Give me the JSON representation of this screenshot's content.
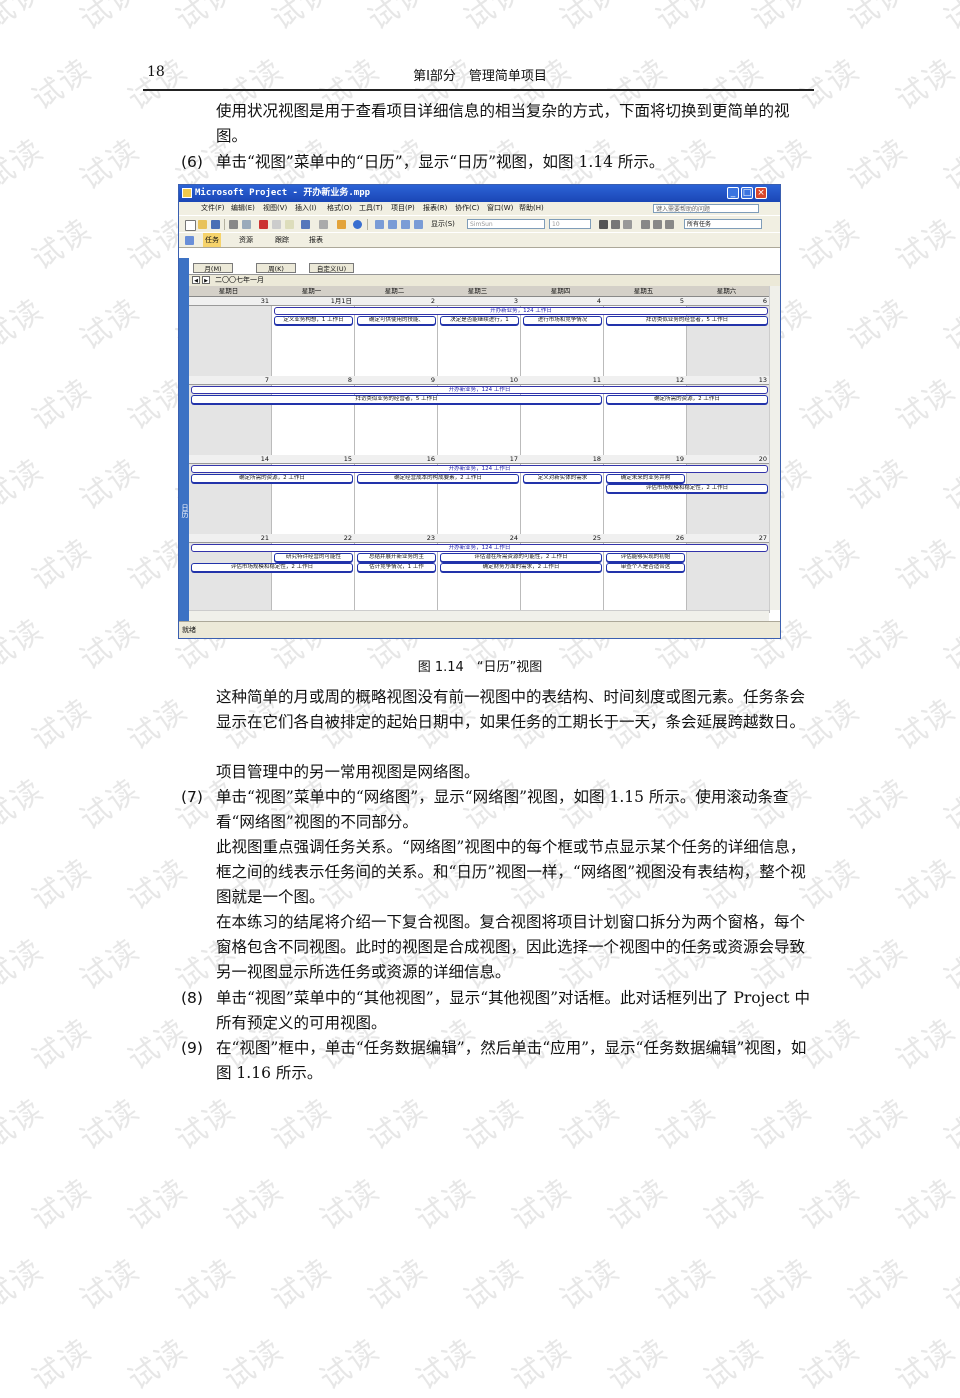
{
  "header": {
    "page_number": "18",
    "running_head": "第Ⅰ部分　管理简单项目"
  },
  "watermark": "试读",
  "text": {
    "p_intro": "使用状况视图是用于查看项目详细信息的相当复杂的方式，下面将切换到更简单的视图。",
    "step6_no": "(6)",
    "step6": "单击“视图”菜单中的“日历”，显示“日历”视图，如图 1.14 所示。",
    "p_simple": "这种简单的月或周的概略视图没有前一视图中的表结构、时间刻度或图元素。任务条会显示在它们各自被排定的起始日期中，如果任务的工期长于一天，条会延展跨越数日。",
    "p_network": "项目管理中的另一常用视图是网络图。",
    "step7_no": "(7)",
    "step7": "单击“视图”菜单中的“网络图”，显示“网络图”视图，如图 1.15 所示。使用滚动条查看“网络图”视图的不同部分。",
    "p_focus": "此视图重点强调任务关系。“网络图”视图中的每个框或节点显示某个任务的详细信息，框之间的线表示任务间的关系。和“日历”视图一样，“网络图”视图没有表结构，整个视图就是一个图。",
    "p_composite": "在本练习的结尾将介绍一下复合视图。复合视图将项目计划窗口拆分为两个窗格，每个窗格包含不同视图。此时的视图是合成视图，因此选择一个视图中的任务或资源会导致另一视图显示所选任务或资源的详细信息。",
    "step8_no": "(8)",
    "step8": "单击“视图”菜单中的“其他视图”，显示“其他视图”对话框。此对话框列出了 Project 中所有预定义的可用视图。",
    "step9_no": "(9)",
    "step9": "在“视图”框中，单击“任务数据编辑”，然后单击“应用”，显示“任务数据编辑”视图，如图 1.16 所示。"
  },
  "figure": {
    "caption": "图 1.14　“日历”视图",
    "window_title": "Microsoft Project - 开办新业务.mpp",
    "menu": [
      "文件(F)",
      "编辑(E)",
      "视图(V)",
      "插入(I)",
      "格式(O)",
      "工具(T)",
      "项目(P)",
      "报表(R)",
      "协作(C)",
      "窗口(W)",
      "帮助(H)"
    ],
    "help_placeholder": "键入需要帮助的问题",
    "toolbar_show": "显示(S)",
    "font_combo": "SimSun",
    "size_combo": "10",
    "filter_combo": "所有任务",
    "toolbar2": [
      "任务",
      "资源",
      "跟踪",
      "报表"
    ],
    "view_buttons": [
      "月(M)",
      "周(K)",
      "自定义(U)"
    ],
    "month_label": "二〇〇七年一月",
    "days": [
      "星期日",
      "星期一",
      "星期二",
      "星期三",
      "星期四",
      "星期五",
      "星期六"
    ],
    "view_bar_label": "日历",
    "status": "就绪",
    "weeks": [
      {
        "dates": [
          "31",
          "1月1日",
          "2",
          "3",
          "4",
          "5",
          "6"
        ],
        "summary": "开办新业务，124 工作日",
        "tasks": [
          "定义业务构想，1 工作日",
          "确定可供使用的技能、",
          "决定是否能继续进行，1",
          "进行市场和竞争情况",
          "拜访类似业务的经营者，5 工作日"
        ]
      },
      {
        "dates": [
          "7",
          "8",
          "9",
          "10",
          "11",
          "12",
          "13"
        ],
        "summary": "开办新业务，124 工作日",
        "tasks": [
          "拜访类似业务的经营者，5 工作日",
          "确定所需的资源，2 工作日"
        ]
      },
      {
        "dates": [
          "14",
          "15",
          "16",
          "17",
          "18",
          "19",
          "20"
        ],
        "summary": "开办新业务，124 工作日",
        "tasks": [
          "确定所需的资源，2 工作日",
          "确定经营成本的构成要素，2 工作日",
          "定义对新实体的需求",
          "确定未来的业务并购",
          "评估市场规模和稳定性，2 工作日"
        ]
      },
      {
        "dates": [
          "21",
          "22",
          "23",
          "24",
          "25",
          "26",
          "27"
        ],
        "summary": "开办新业务，124 工作日",
        "tasks": [
          "研究特许经营的可能性",
          "总结并展开新业务的主",
          "评估潜在所需资源的可能性，2 工作日",
          "评估能够实现的初始",
          "评估市场规模和稳定性，2 工作日",
          "估计竞争情况，1 工作",
          "确定财务方面的需求，2 工作日",
          "审查个人是否适合这"
        ]
      }
    ]
  }
}
